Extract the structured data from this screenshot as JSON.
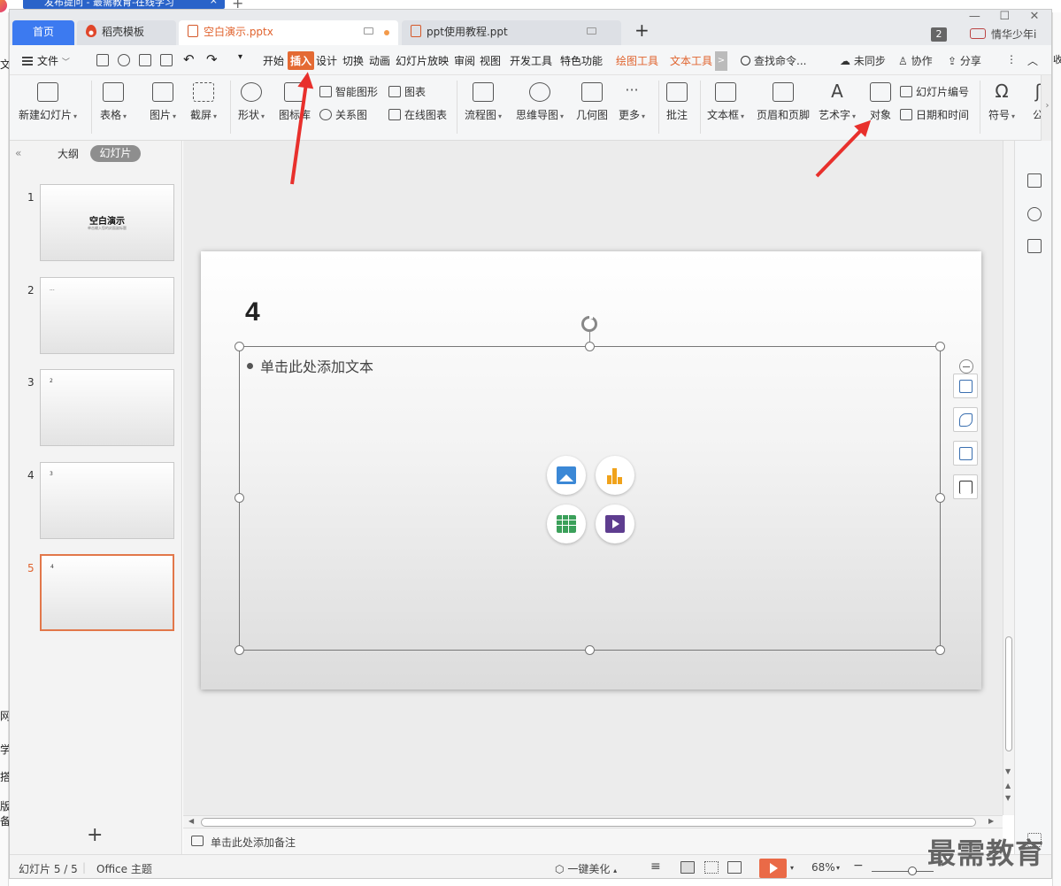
{
  "browser": {
    "tab_title": "发布提问 - 最需教育-在线学习",
    "close": "×",
    "new_tab": "+"
  },
  "left_edge_chars": [
    "文",
    "网",
    "学",
    "搭",
    "版",
    "备"
  ],
  "right_edge_chars": [
    "收"
  ],
  "window": {
    "minimize": "—",
    "maximize": "☐",
    "close": "✕"
  },
  "tabs": [
    {
      "label": "首页"
    },
    {
      "label": "稻壳模板"
    },
    {
      "label": "空白演示.pptx"
    },
    {
      "label": "ppt使用教程.ppt"
    }
  ],
  "tab_add": "+",
  "account": {
    "badge": "2",
    "user": "情华少年i"
  },
  "menu": {
    "file": "文件",
    "items": [
      "开始",
      "插入",
      "设计",
      "切换",
      "动画",
      "幻灯片放映",
      "审阅",
      "视图",
      "开发工具",
      "特色功能"
    ],
    "context_tabs": [
      "绘图工具",
      "文本工具"
    ],
    "more": ">",
    "search": "查找命令...",
    "sync": "未同步",
    "collab": "协作",
    "share": "分享",
    "kebab": "⋮",
    "collapse": "︿"
  },
  "ribbon": {
    "new_slide": "新建幻灯片",
    "table": "表格",
    "picture": "图片",
    "screenshot": "截屏",
    "shape": "形状",
    "icon_lib": "图标库",
    "smart_art": "智能图形",
    "relation": "关系图",
    "chart": "图表",
    "online_chart": "在线图表",
    "flowchart": "流程图",
    "mindmap": "思维导图",
    "geometry": "几何图",
    "more": "更多",
    "comment": "批注",
    "textbox": "文本框",
    "header_footer": "页眉和页脚",
    "wordart": "艺术字",
    "object": "对象",
    "slide_number": "幻灯片编号",
    "date_time": "日期和时间",
    "symbol": "符号",
    "formula": "公"
  },
  "panel": {
    "collapse": "«",
    "outline": "大纲",
    "slides": "幻灯片",
    "add": "+",
    "thumbs": [
      {
        "num": "1",
        "title": "空白演示",
        "sub": "单击输入您的封面副标题",
        "text": ""
      },
      {
        "num": "2",
        "title": "",
        "sub": "",
        "text": "..."
      },
      {
        "num": "3",
        "title": "",
        "sub": "",
        "text": "2"
      },
      {
        "num": "4",
        "title": "",
        "sub": "",
        "text": "3"
      },
      {
        "num": "5",
        "title": "",
        "sub": "",
        "text": "4"
      }
    ]
  },
  "slide": {
    "title": "4",
    "placeholder": "单击此处添加文本"
  },
  "notes": {
    "placeholder": "单击此处添加备注"
  },
  "status": {
    "slide_info": "幻灯片 5 / 5",
    "theme": "Office 主题",
    "beautify": "一键美化",
    "zoom": "68%",
    "zoom_level": 0.68,
    "minus": "−",
    "plus": "+"
  },
  "watermark": "最需教育",
  "colors": {
    "accent": "#e0632e",
    "home_tab": "#3c7af0",
    "arrow": "#e8302c"
  }
}
